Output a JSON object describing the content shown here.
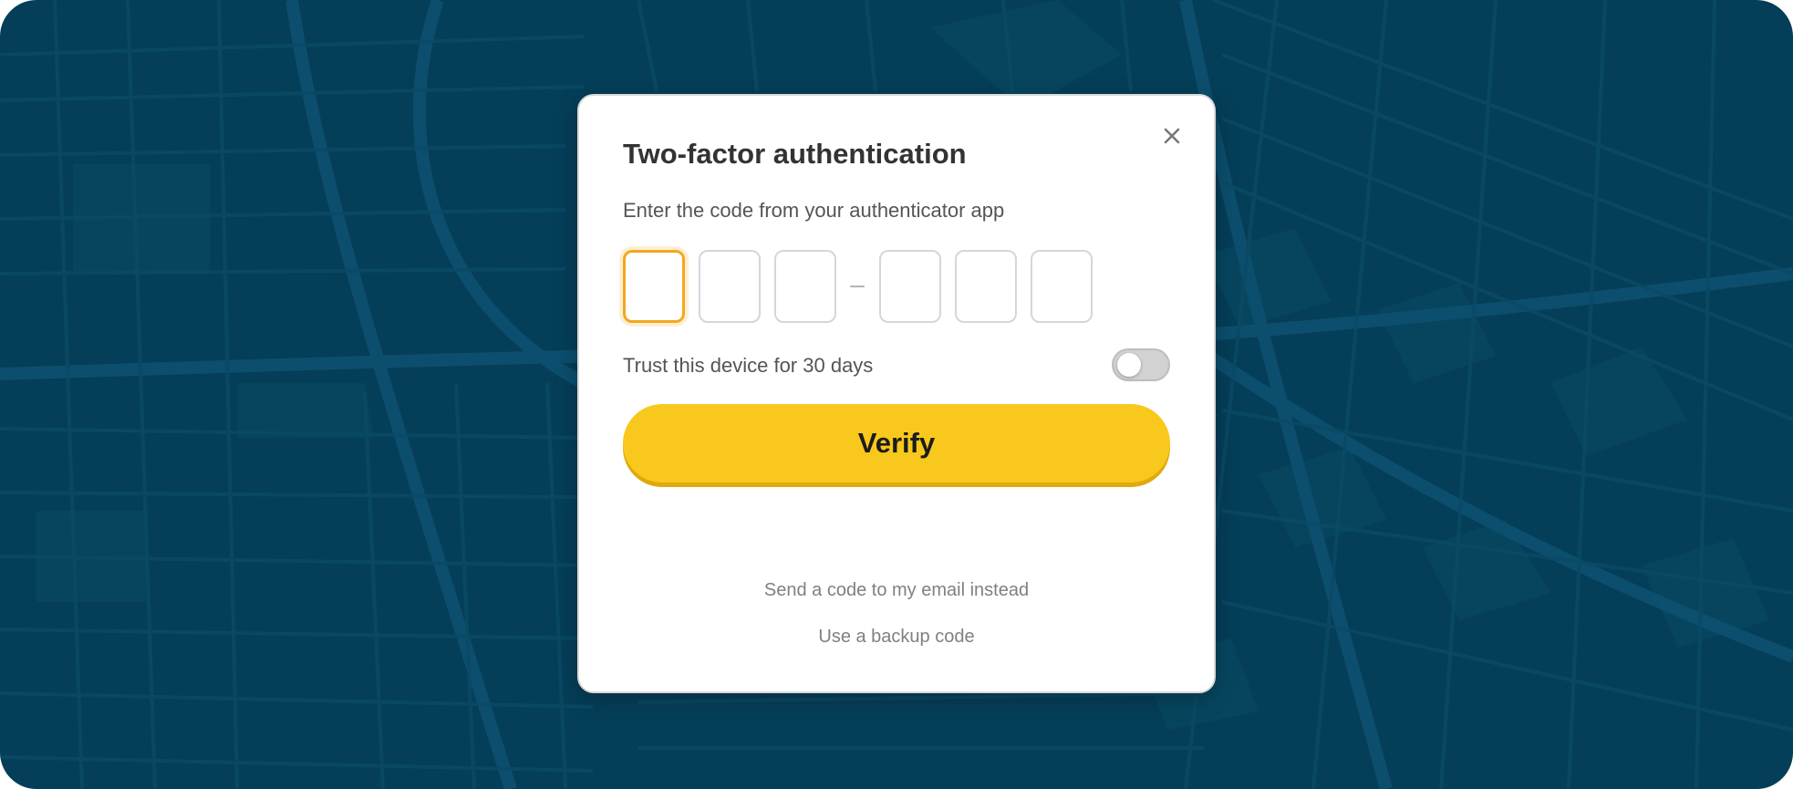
{
  "modal": {
    "title": "Two-factor authentication",
    "subtitle": "Enter the code from your authenticator app",
    "close_icon": "close-icon",
    "code_inputs": {
      "digits": [
        "",
        "",
        "",
        "",
        "",
        ""
      ],
      "active_index": 0,
      "separator": "–"
    },
    "trust_device": {
      "label": "Trust this device for 30 days",
      "enabled": false
    },
    "verify_button": {
      "label": "Verify"
    },
    "links": {
      "email_instead": "Send a code to my email instead",
      "backup_code": "Use a backup code"
    }
  },
  "colors": {
    "backdrop": "#053e58",
    "accent": "#f8c81c",
    "active_border": "#f2a81d",
    "text_primary": "#333333",
    "text_secondary": "#555555",
    "link": "#808080"
  }
}
